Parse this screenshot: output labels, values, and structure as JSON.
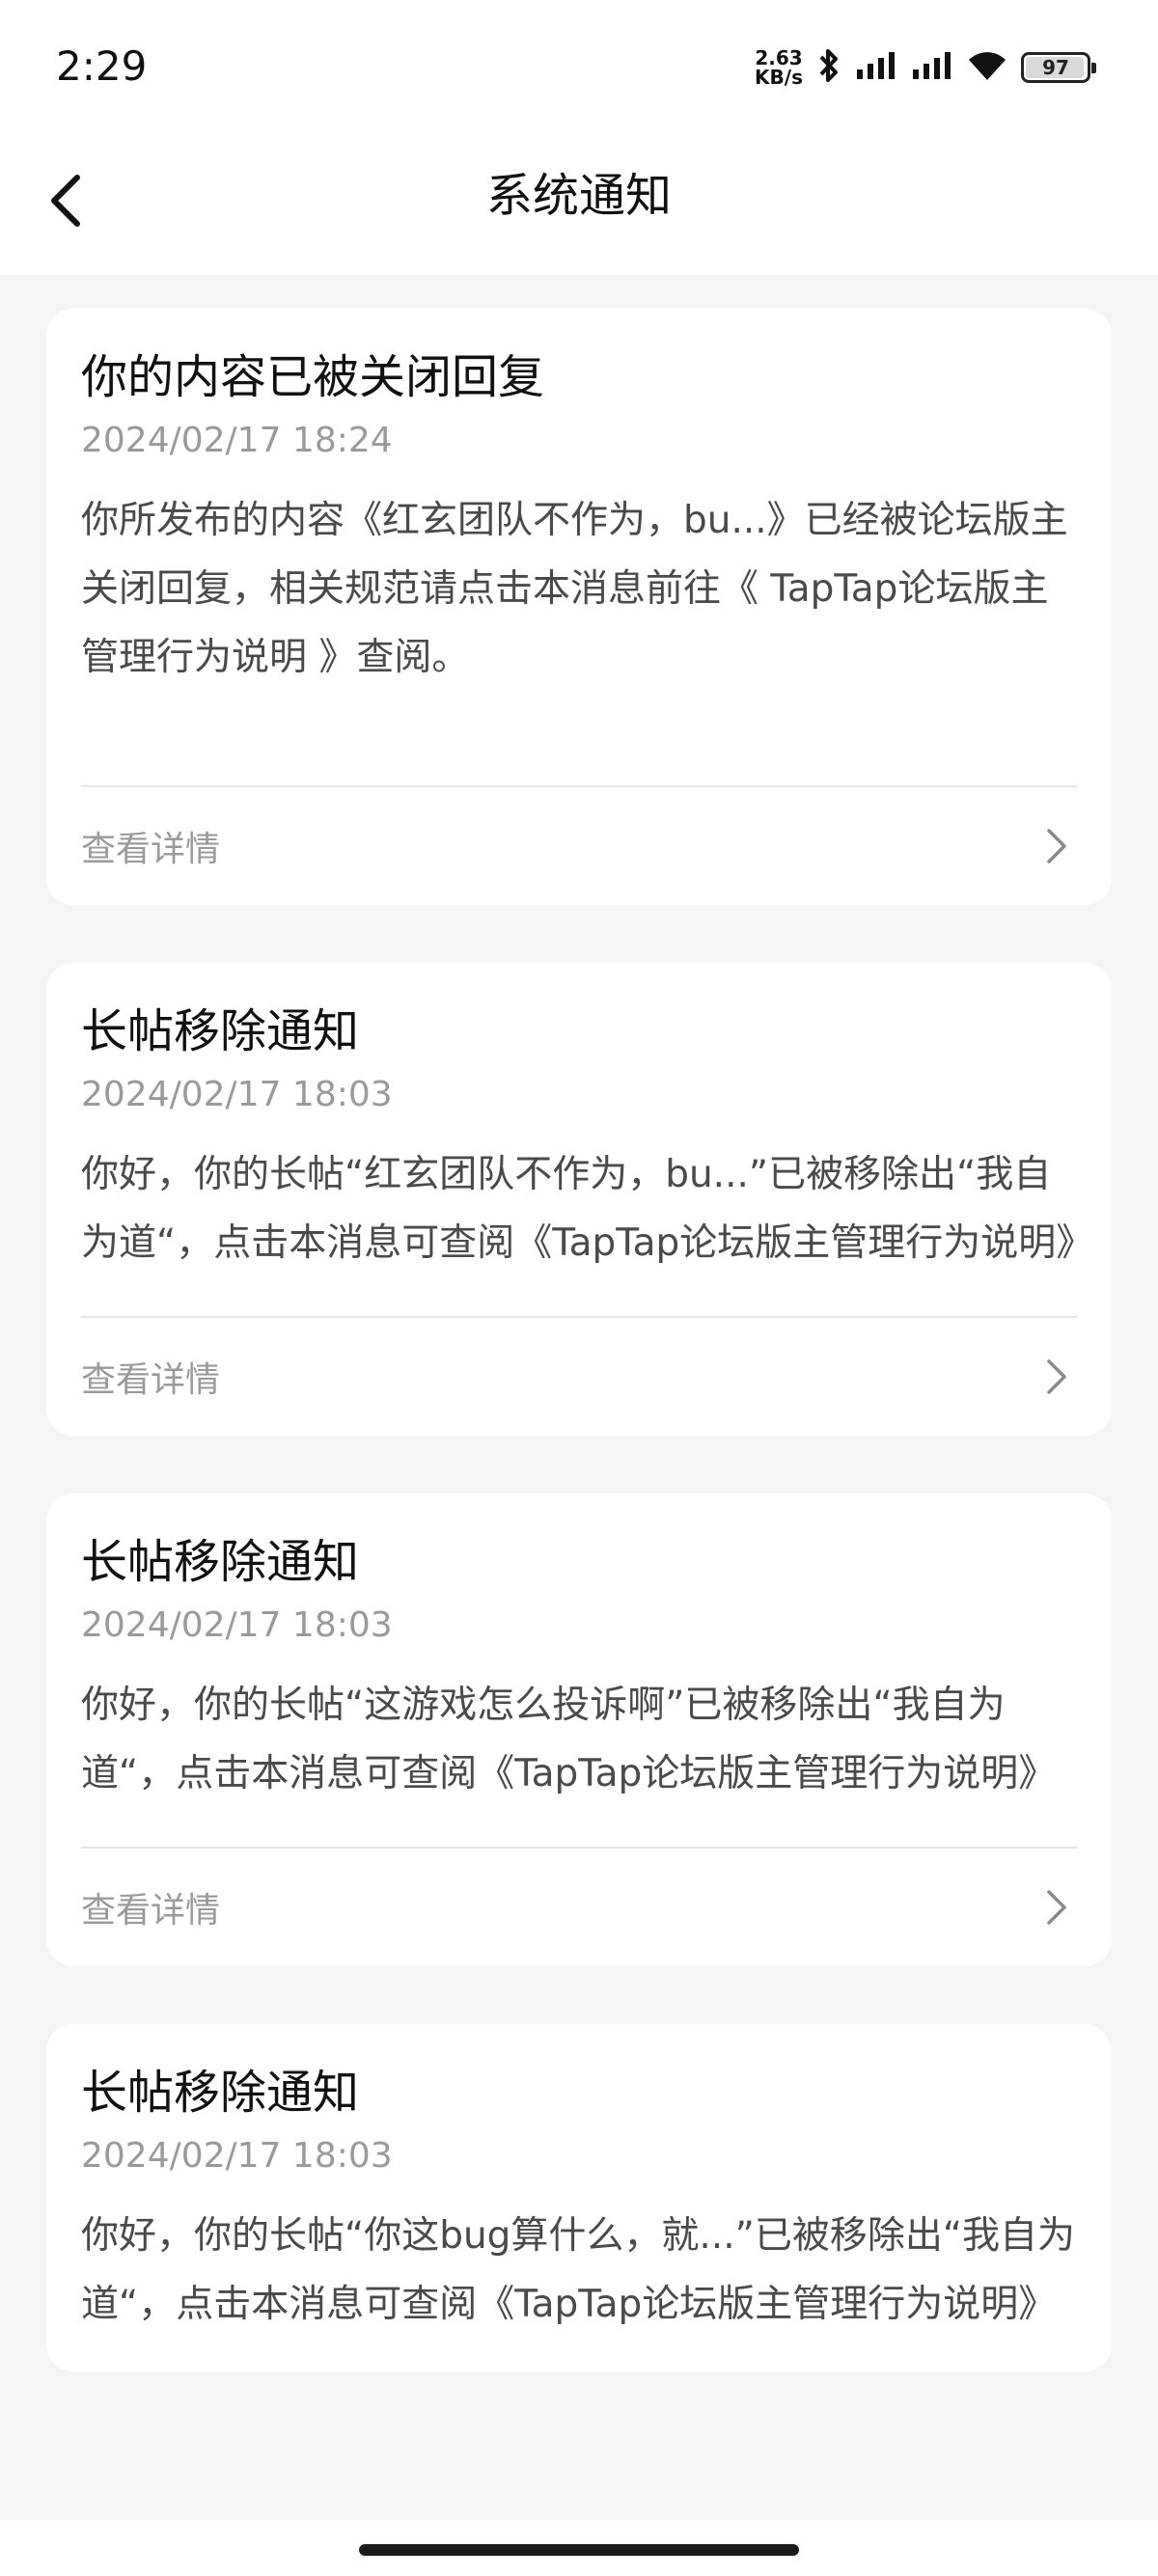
{
  "status_bar": {
    "time": "2:29",
    "net_speed_value": "2.63",
    "net_speed_unit": "KB/s",
    "battery": "97",
    "icons": [
      "bluetooth-icon",
      "signal-icon",
      "signal-icon",
      "wifi-icon",
      "battery-icon"
    ]
  },
  "header": {
    "title": "系统通知",
    "back_icon": "chevron-left-icon"
  },
  "notifications": [
    {
      "title": "你的内容已被关闭回复",
      "time": "2024/02/17 18:24",
      "body": "你所发布的内容《红玄团队不作为，bu...》已经被论坛版主关闭回复，相关规范请点击本消息前往《 TapTap论坛版主管理行为说明 》查阅。",
      "detail_label": "查看详情"
    },
    {
      "title": "长帖移除通知",
      "time": "2024/02/17 18:03",
      "body": "你好，你的长帖“红玄团队不作为，bu...”已被移除出“我自为道“，点击本消息可查阅《TapTap论坛版主管理行为说明》",
      "detail_label": "查看详情"
    },
    {
      "title": "长帖移除通知",
      "time": "2024/02/17 18:03",
      "body": "你好，你的长帖“这游戏怎么投诉啊”已被移除出“我自为道“，点击本消息可查阅《TapTap论坛版主管理行为说明》",
      "detail_label": "查看详情"
    },
    {
      "title": "长帖移除通知",
      "time": "2024/02/17 18:03",
      "body": "你好，你的长帖“你这bug算什么，就...”已被移除出“我自为道“，点击本消息可查阅《TapTap论坛版主管理行为说明》"
    }
  ],
  "colors": {
    "background": "#f4f5f7",
    "card": "#ffffff",
    "secondary_text": "#9a9a9a"
  }
}
